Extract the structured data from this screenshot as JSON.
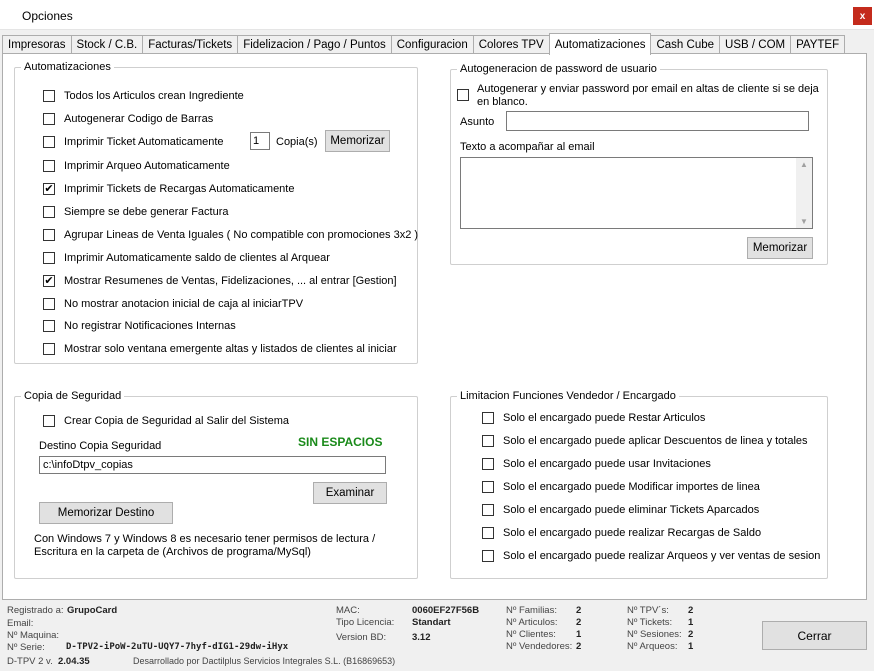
{
  "window": {
    "title": "Opciones",
    "close": "x"
  },
  "tabs": [
    "Impresoras",
    "Stock / C.B.",
    "Facturas/Tickets",
    "Fidelizacion / Pago / Puntos",
    "Configuracion",
    "Colores TPV",
    "Automatizaciones",
    "Cash Cube",
    "USB / COM",
    "PAYTEF"
  ],
  "active_tab": "Automatizaciones",
  "automatizaciones": {
    "legend": "Automatizaciones",
    "items": [
      {
        "label": "Todos los Articulos crean Ingrediente",
        "checked": false
      },
      {
        "label": "Autogenerar Codigo de Barras",
        "checked": false
      },
      {
        "label": "Imprimir Ticket Automaticamente",
        "checked": false
      },
      {
        "label": "Imprimir Arqueo Automaticamente",
        "checked": false
      },
      {
        "label": "Imprimir Tickets de Recargas Automaticamente",
        "checked": true
      },
      {
        "label": "Siempre se debe generar Factura",
        "checked": false
      },
      {
        "label": "Agrupar Lineas de Venta Iguales ( No compatible con promociones 3x2 )",
        "checked": false
      },
      {
        "label": "Imprimir Automaticamente saldo de clientes al Arquear",
        "checked": false
      },
      {
        "label": "Mostrar Resumenes de Ventas, Fidelizaciones, ... al entrar [Gestion]",
        "checked": true
      },
      {
        "label": "No mostrar anotacion inicial de caja al iniciarTPV",
        "checked": false
      },
      {
        "label": "No registrar Notificaciones Internas",
        "checked": false
      },
      {
        "label": "Mostrar solo ventana emergente altas y listados de clientes al iniciar",
        "checked": false
      }
    ],
    "copies_value": "1",
    "copies_label": "Copia(s)",
    "memorize_label": "Memorizar"
  },
  "password": {
    "legend": "Autogeneracion de password de usuario",
    "auto_label_line1": "Autogenerar y enviar password por email en altas de cliente si se deja",
    "auto_label_line2": "en blanco.",
    "auto_checked": false,
    "subject_label": "Asunto",
    "subject_value": "",
    "text_label": "Texto a acompañar al email",
    "text_value": "",
    "memorize_label": "Memorizar"
  },
  "backup": {
    "legend": "Copia de Seguridad",
    "create_label": "Crear Copia de Seguridad al Salir del Sistema",
    "create_checked": false,
    "dest_label": "Destino Copia Seguridad",
    "warning": "SIN ESPACIOS",
    "warning_color": "#1a8a1a",
    "dest_value": "c:\\infoDtpv_copias",
    "browse_label": "Examinar",
    "memorize_label": "Memorizar Destino",
    "note_line1": "Con Windows 7 y Windows 8 es necesario tener permisos de lectura /",
    "note_line2": "Escritura en la carpeta de (Archivos de programa/MySql)"
  },
  "limits": {
    "legend": "Limitacion Funciones Vendedor / Encargado",
    "items": [
      {
        "label": "Solo el encargado puede Restar  Articulos",
        "checked": false
      },
      {
        "label": "Solo el encargado puede aplicar Descuentos de linea y totales",
        "checked": false
      },
      {
        "label": "Solo el encargado puede usar Invitaciones",
        "checked": false
      },
      {
        "label": "Solo el encargado puede Modificar importes de linea",
        "checked": false
      },
      {
        "label": "Solo el encargado puede eliminar Tickets Aparcados",
        "checked": false
      },
      {
        "label": "Solo el encargado puede realizar Recargas de Saldo",
        "checked": false
      },
      {
        "label": "Solo el encargado puede realizar Arqueos y ver ventas de sesion",
        "checked": false
      }
    ]
  },
  "footer": {
    "registered_label": "Registrado a:",
    "registered_value": "GrupoCard",
    "email_label": "Email:",
    "machine_label": "Nº Maquina:",
    "serial_label": "Nº Serie:",
    "serial_value": "D-TPV2-iPoW-2uTU-UQY7-7hyf-dIG1-29dw-iHyx",
    "version_label": "D-TPV 2 v.",
    "version_value": "2.04.35",
    "developer": "Desarrollado por Dactilplus Servicios Integrales S.L. (B16869653)",
    "mac_label": "MAC:",
    "mac_value": "0060EF27F56B",
    "license_label": "Tipo Licencia:",
    "license_value": "Standart",
    "dbversion_label": "Version BD:",
    "dbversion_value": "3.12",
    "families_label": "Nº Familias:",
    "families_value": "2",
    "articles_label": "Nº Articulos:",
    "articles_value": "2",
    "clients_label": "Nº Clientes:",
    "clients_value": "1",
    "sellers_label": "Nº Vendedores:",
    "sellers_value": "2",
    "tpvs_label": "Nº TPV´s:",
    "tpvs_value": "2",
    "tickets_label": "Nº Tickets:",
    "tickets_value": "1",
    "sessions_label": "Nº Sesiones:",
    "sessions_value": "2",
    "arqueos_label": "Nº Arqueos:",
    "arqueos_value": "1",
    "close_label": "Cerrar"
  }
}
